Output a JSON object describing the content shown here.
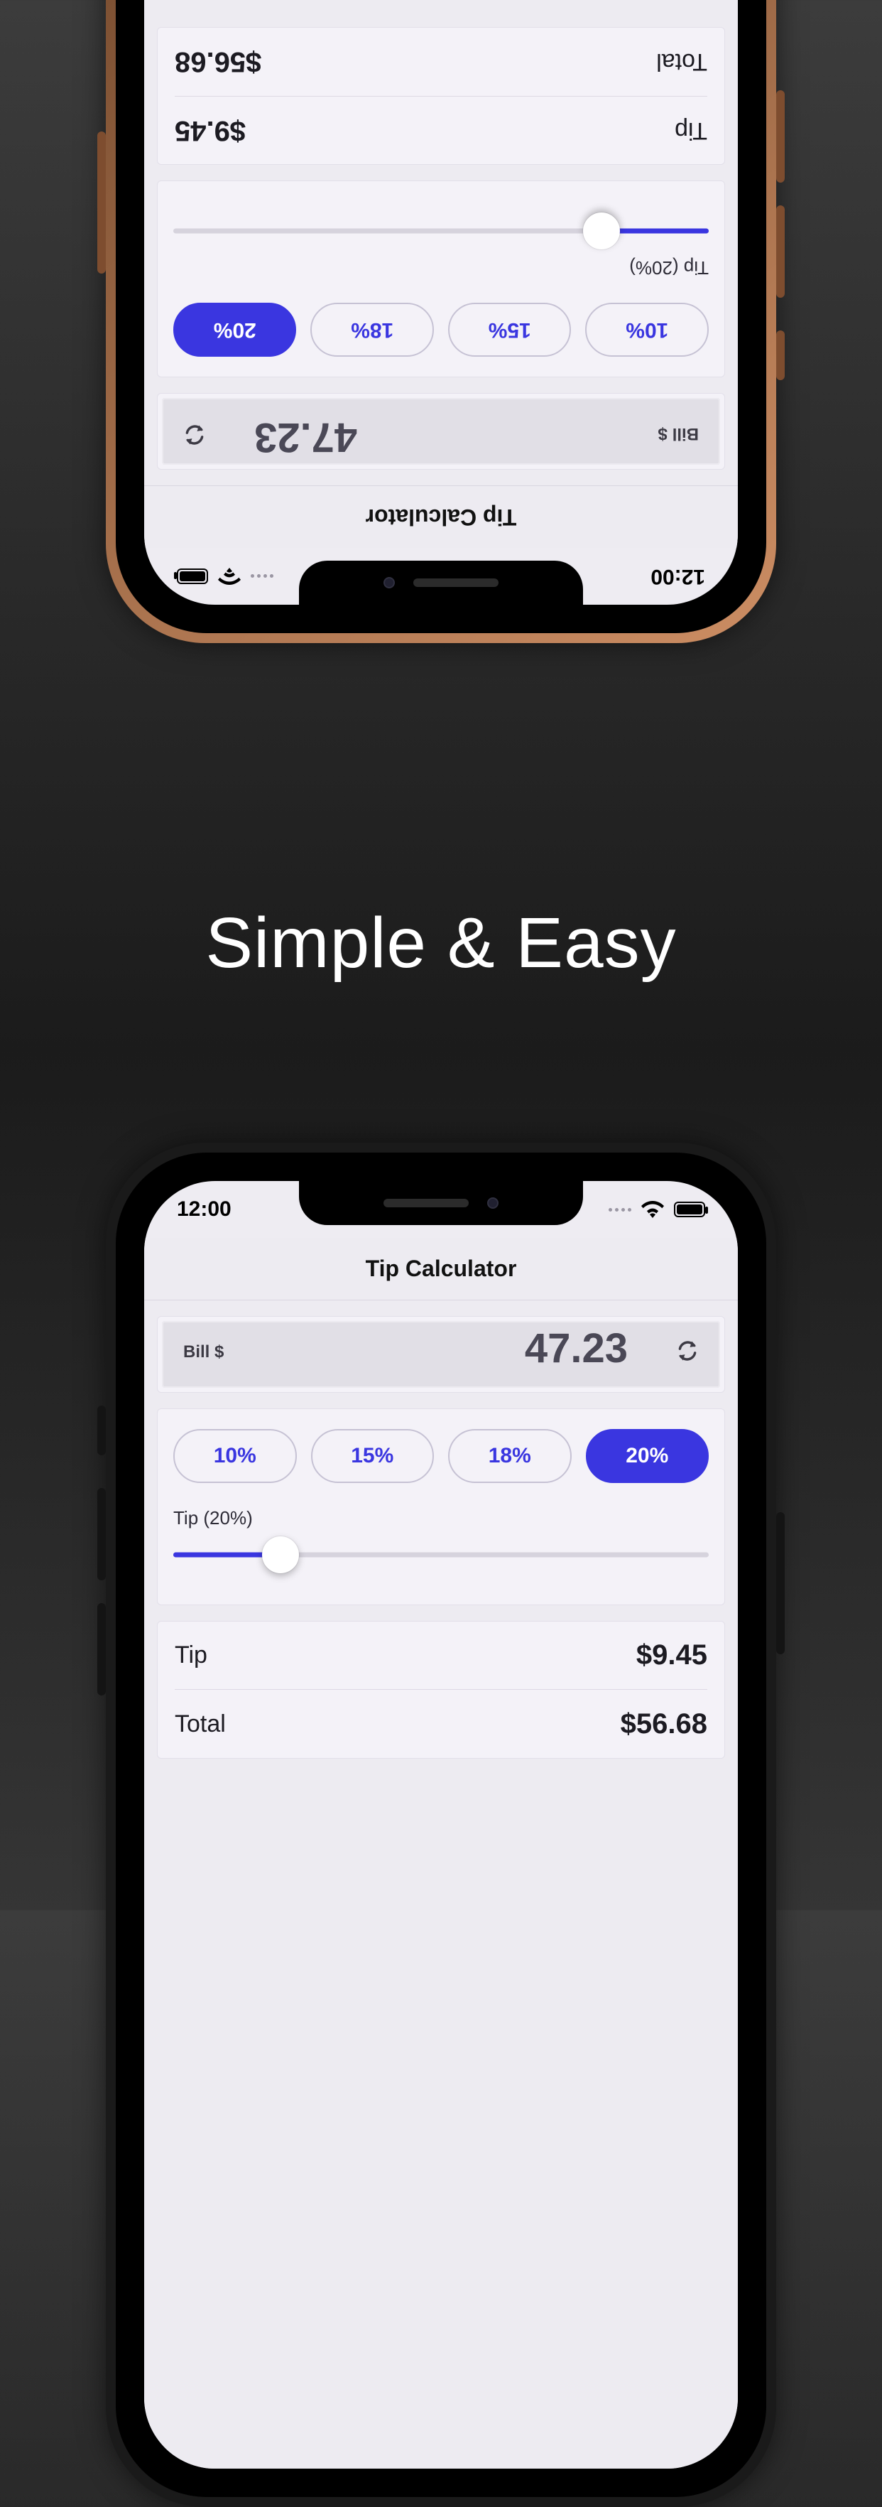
{
  "headline": "Simple & Easy",
  "status": {
    "time": "12:00"
  },
  "nav": {
    "title": "Tip Calculator"
  },
  "bill": {
    "label": "Bill  $",
    "amount": "47.23"
  },
  "tip": {
    "options": [
      "10%",
      "15%",
      "18%",
      "20%"
    ],
    "selected_index": 3,
    "slider_label": "Tip (20%)",
    "slider_percent": 20
  },
  "results": {
    "tip_label": "Tip",
    "tip_value": "$9.45",
    "total_label": "Total",
    "total_value": "$56.68"
  },
  "icons": {
    "reset": "loop-arrows-icon",
    "wifi": "wifi-icon",
    "battery": "battery-icon"
  },
  "colors": {
    "accent": "#3a36e0",
    "screen_bg": "#edebf1",
    "card_bg": "#f4f2f8"
  }
}
